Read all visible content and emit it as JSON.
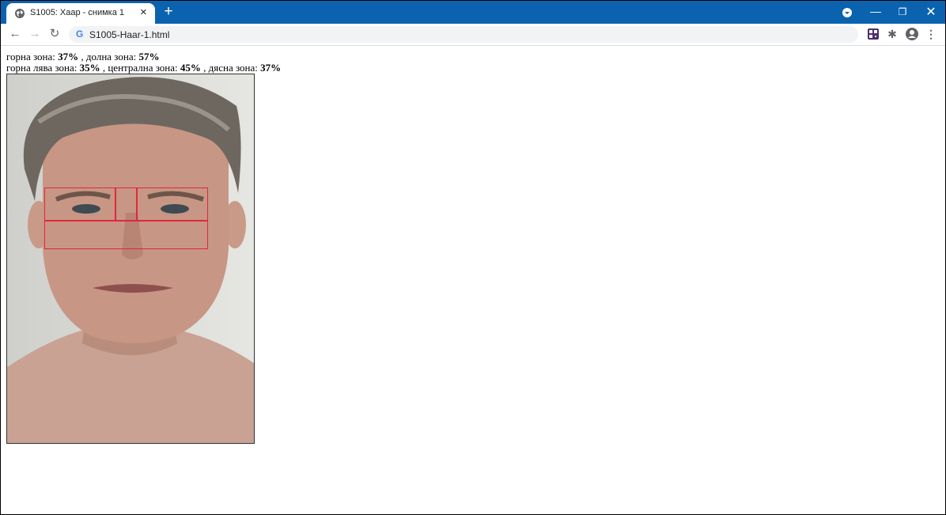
{
  "browser": {
    "tab_title": "S1005: Хаар - снимка 1",
    "url": "S1005-Haar-1.html",
    "accent": "#0b63b0"
  },
  "icons": {
    "tab_favicon": "globe-icon",
    "new_tab": "plus-icon",
    "back": "arrow-left-icon",
    "forward": "arrow-right-icon",
    "reload": "reload-icon",
    "extensions": [
      "qr-extension-icon",
      "puzzle-icon",
      "profile-icon",
      "more-vert-icon"
    ]
  },
  "stats": {
    "line1": {
      "upper_label": "горна зона: ",
      "upper_value": "37%",
      "sep": " , ",
      "lower_label": "долна зона: ",
      "lower_value": "57%"
    },
    "line2": {
      "upper_left_label": "горна лява зона: ",
      "upper_left_value": "35%",
      "sep1": " , ",
      "center_label": "централна зона: ",
      "center_value": "45%",
      "sep2": " , ",
      "right_label": "дясна зона: ",
      "right_value": "37%"
    }
  },
  "image": {
    "subject": "portrait photo of a man with detection rectangles",
    "zone_color": "#e0283c"
  }
}
